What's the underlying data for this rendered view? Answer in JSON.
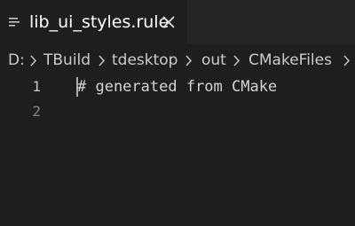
{
  "tab": {
    "label": "lib_ui_styles.rule",
    "icon": "lines-file-icon",
    "close_icon": "close-icon"
  },
  "breadcrumb": [
    "D:",
    "TBuild",
    "tdesktop",
    "out",
    "CMakeFiles"
  ],
  "editor": {
    "lines": [
      {
        "number": "1",
        "text": "# generated from CMake"
      },
      {
        "number": "2",
        "text": ""
      }
    ]
  },
  "colors": {
    "background": "#1e1e1e",
    "tabbar": "#252526",
    "text": "#d4d4d4",
    "line_number": "#858585",
    "breadcrumb": "#cccccc"
  }
}
